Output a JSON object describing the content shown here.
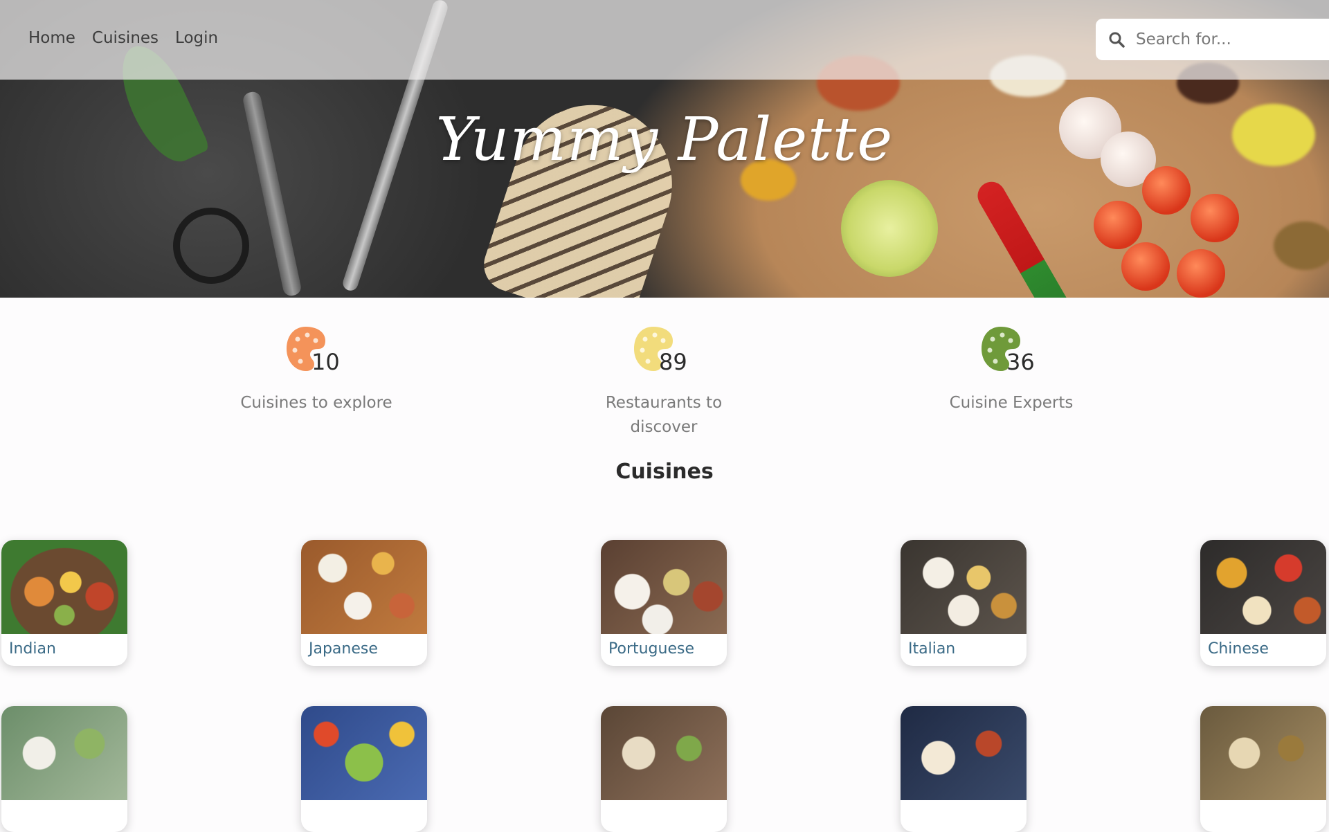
{
  "nav": {
    "links": [
      {
        "label": "Home"
      },
      {
        "label": "Cuisines"
      },
      {
        "label": "Login"
      }
    ],
    "search": {
      "placeholder": "Search for...",
      "icon": "search-icon"
    }
  },
  "hero": {
    "title": "Yummy Palette"
  },
  "stats": [
    {
      "number": "10",
      "label": "Cuisines to explore",
      "color": "#f4935a",
      "icon": "palette-icon"
    },
    {
      "number": "89",
      "label": "Restaurants to discover",
      "color": "#f2dc7c",
      "icon": "palette-icon"
    },
    {
      "number": "36",
      "label": "Cuisine Experts",
      "color": "#6f9a3a",
      "icon": "palette-icon"
    }
  ],
  "section": {
    "title": "Cuisines"
  },
  "cuisines": [
    {
      "label": "Indian"
    },
    {
      "label": "Japanese"
    },
    {
      "label": "Portuguese"
    },
    {
      "label": "Italian"
    },
    {
      "label": "Chinese"
    }
  ],
  "colors": {
    "card_label": "#3a6a86",
    "nav_text": "#3d3d3d",
    "stat_label": "#7a7a7a"
  }
}
